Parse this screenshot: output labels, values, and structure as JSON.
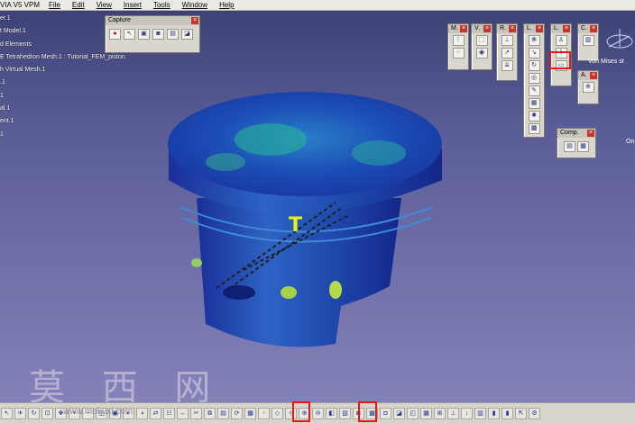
{
  "menubar": {
    "app_title": "VIA V5 VPM",
    "items": [
      "File",
      "Edit",
      "View",
      "Insert",
      "Tools",
      "Window",
      "Help"
    ]
  },
  "tree": [
    "er.1",
    "t Model.1",
    "d Elements",
    "E Tetrahedron Mesh.1 : Tutorial_FEM_piston",
    "h Virtual Mesh.1",
    ".1",
    "1",
    "al.1",
    "ent.1",
    "1"
  ],
  "capture_toolbar": {
    "title": "Capture",
    "icons": [
      "record-icon",
      "select-icon",
      "frame-icon",
      "camera-icon",
      "film-icon",
      "image-icon"
    ]
  },
  "mini_toolbars": [
    {
      "title": "M."
    },
    {
      "title": "V."
    },
    {
      "title": "R."
    },
    {
      "title": "L."
    },
    {
      "title": "L."
    },
    {
      "title": "C."
    },
    {
      "title": "A."
    },
    {
      "title": "Comp."
    }
  ],
  "right_label": "Von Mises st",
  "right_label2": "On",
  "annotation_letter": "T",
  "watermark": "莫 西 网",
  "watermark_url": "www.mokuxi.com",
  "colors": {
    "bg_top": "#3a3f73",
    "bg_bottom": "#8784bb",
    "highlight": "#e3161b"
  }
}
